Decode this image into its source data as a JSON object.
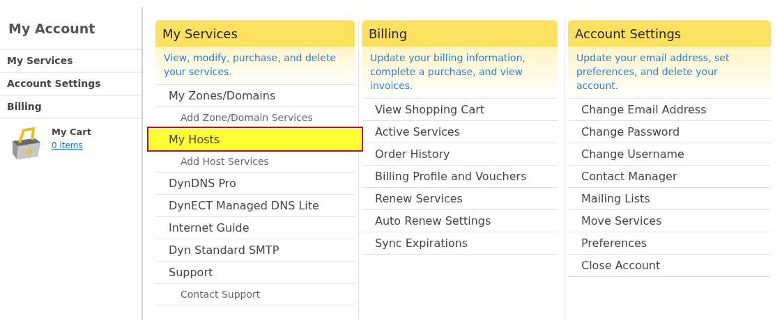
{
  "sidebar": {
    "title": "My Account",
    "items": [
      "My Services",
      "Account Settings",
      "Billing"
    ],
    "cart": {
      "label": "My Cart",
      "link": "0 items"
    }
  },
  "panels": [
    {
      "title": "My Services",
      "description": "View, modify, purchase, and delete your services.",
      "items": [
        {
          "label": "My Zones/Domains",
          "kind": "main",
          "highlighted": false
        },
        {
          "label": "Add Zone/Domain Services",
          "kind": "sub",
          "highlighted": false
        },
        {
          "label": "My Hosts",
          "kind": "main",
          "highlighted": true
        },
        {
          "label": "Add Host Services",
          "kind": "sub",
          "highlighted": false
        },
        {
          "label": "DynDNS Pro",
          "kind": "main",
          "highlighted": false
        },
        {
          "label": "DynECT Managed DNS Lite",
          "kind": "main",
          "highlighted": false
        },
        {
          "label": "Internet Guide",
          "kind": "main",
          "highlighted": false
        },
        {
          "label": "Dyn Standard SMTP",
          "kind": "main",
          "highlighted": false
        },
        {
          "label": "Support",
          "kind": "main",
          "highlighted": false
        },
        {
          "label": "Contact Support",
          "kind": "sub",
          "highlighted": false
        }
      ]
    },
    {
      "title": "Billing",
      "description": "Update your billing information, complete a purchase, and view invoices.",
      "items": [
        {
          "label": "View Shopping Cart",
          "kind": "main",
          "highlighted": false
        },
        {
          "label": "Active Services",
          "kind": "main",
          "highlighted": false
        },
        {
          "label": "Order History",
          "kind": "main",
          "highlighted": false
        },
        {
          "label": "Billing Profile and Vouchers",
          "kind": "main",
          "highlighted": false
        },
        {
          "label": "Renew Services",
          "kind": "main",
          "highlighted": false
        },
        {
          "label": "Auto Renew Settings",
          "kind": "main",
          "highlighted": false
        },
        {
          "label": "Sync Expirations",
          "kind": "main",
          "highlighted": false
        }
      ]
    },
    {
      "title": "Account Settings",
      "description": "Update your email address, set preferences, and delete your account.",
      "items": [
        {
          "label": "Change Email Address",
          "kind": "main",
          "highlighted": false
        },
        {
          "label": "Change Password",
          "kind": "main",
          "highlighted": false
        },
        {
          "label": "Change Username",
          "kind": "main",
          "highlighted": false
        },
        {
          "label": "Contact Manager",
          "kind": "main",
          "highlighted": false
        },
        {
          "label": "Mailing Lists",
          "kind": "main",
          "highlighted": false
        },
        {
          "label": "Move Services",
          "kind": "main",
          "highlighted": false
        },
        {
          "label": "Preferences",
          "kind": "main",
          "highlighted": false
        },
        {
          "label": "Close Account",
          "kind": "main",
          "highlighted": false
        }
      ]
    }
  ]
}
